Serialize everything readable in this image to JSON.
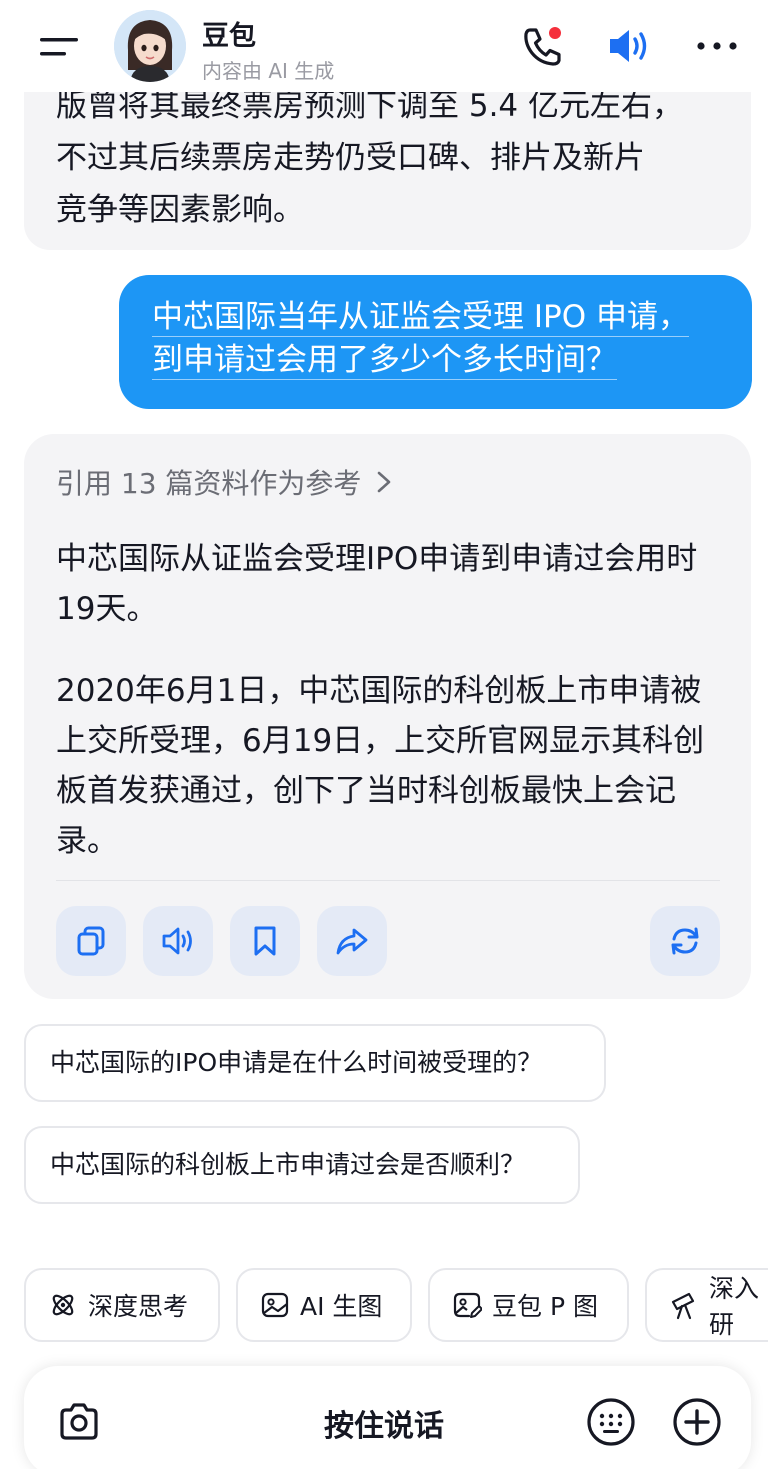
{
  "header": {
    "bot_name": "豆包",
    "bot_subtitle": "内容由 AI 生成",
    "icons": [
      "menu-icon",
      "avatar",
      "phone-icon",
      "speaker-icon",
      "more-icon"
    ],
    "call_dot_color": "#f5303c",
    "speaker_color": "#1d6ff2"
  },
  "previous_message": {
    "lines": [
      "版曾将其最终票房预测下调至 5.4 亿元左右，",
      "不过其后续票房走势仍受口碑、排片及新片",
      "竞争等因素影响。"
    ]
  },
  "user_message": {
    "lines": [
      "中芯国际当年从证监会受理 IPO 申请，",
      "到申请过会用了多少个多长时间？"
    ]
  },
  "reply": {
    "reference_label": "引用 13 篇资料作为参考",
    "paragraph1": "中芯国际从证监会受理IPO申请到申请过会用时19天。",
    "paragraph2": "2020年6月1日，中芯国际的科创板上市申请被上交所受理，6月19日，上交所官网显示其科创板首发获通过，创下了当时科创板最快上会记录。",
    "actions": [
      "copy-icon",
      "read-aloud-icon",
      "bookmark-icon",
      "share-icon",
      "regenerate-icon"
    ]
  },
  "suggestions": [
    "中芯国际的IPO申请是在什么时间被受理的？",
    "中芯国际的科创板上市申请过会是否顺利？"
  ],
  "tools": [
    {
      "label": "深度思考",
      "icon": "atom-icon"
    },
    {
      "label": "AI 生图",
      "icon": "image-icon"
    },
    {
      "label": "豆包 P 图",
      "icon": "image-edit-icon"
    },
    {
      "label": "深入研",
      "icon": "telescope-icon"
    }
  ],
  "input": {
    "hold_to_talk": "按住说话",
    "icons": [
      "camera-icon",
      "keyboard-icon",
      "plus-icon"
    ]
  }
}
